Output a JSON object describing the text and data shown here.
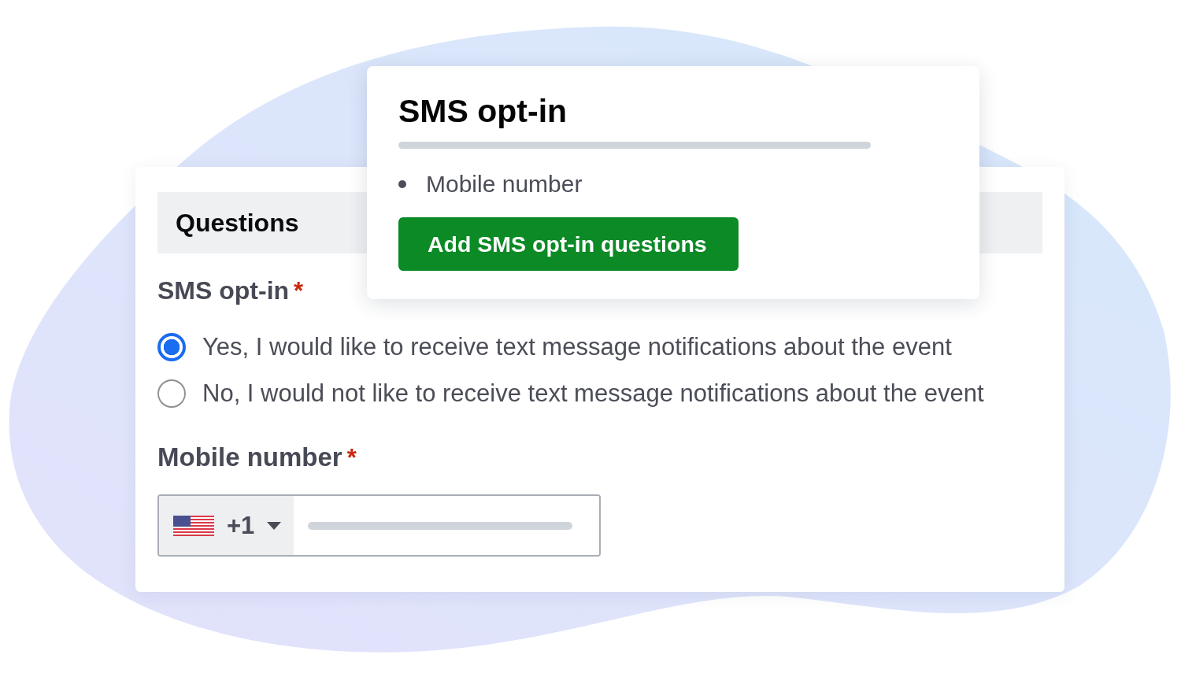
{
  "popup": {
    "title": "SMS opt-in",
    "items": [
      "Mobile number"
    ],
    "button": "Add SMS opt-in questions"
  },
  "form": {
    "section_title": "Questions",
    "fields": [
      {
        "kind": "radio_group",
        "label": "SMS opt-in",
        "required_mark": "*",
        "options": [
          {
            "label": "Yes, I would like to receive text message notifications about the event",
            "selected": true
          },
          {
            "label": "No, I would not like to receive text message notifications about the event",
            "selected": false
          }
        ]
      },
      {
        "kind": "phone",
        "label": "Mobile number",
        "required_mark": "*",
        "country_code": "+1"
      }
    ]
  }
}
